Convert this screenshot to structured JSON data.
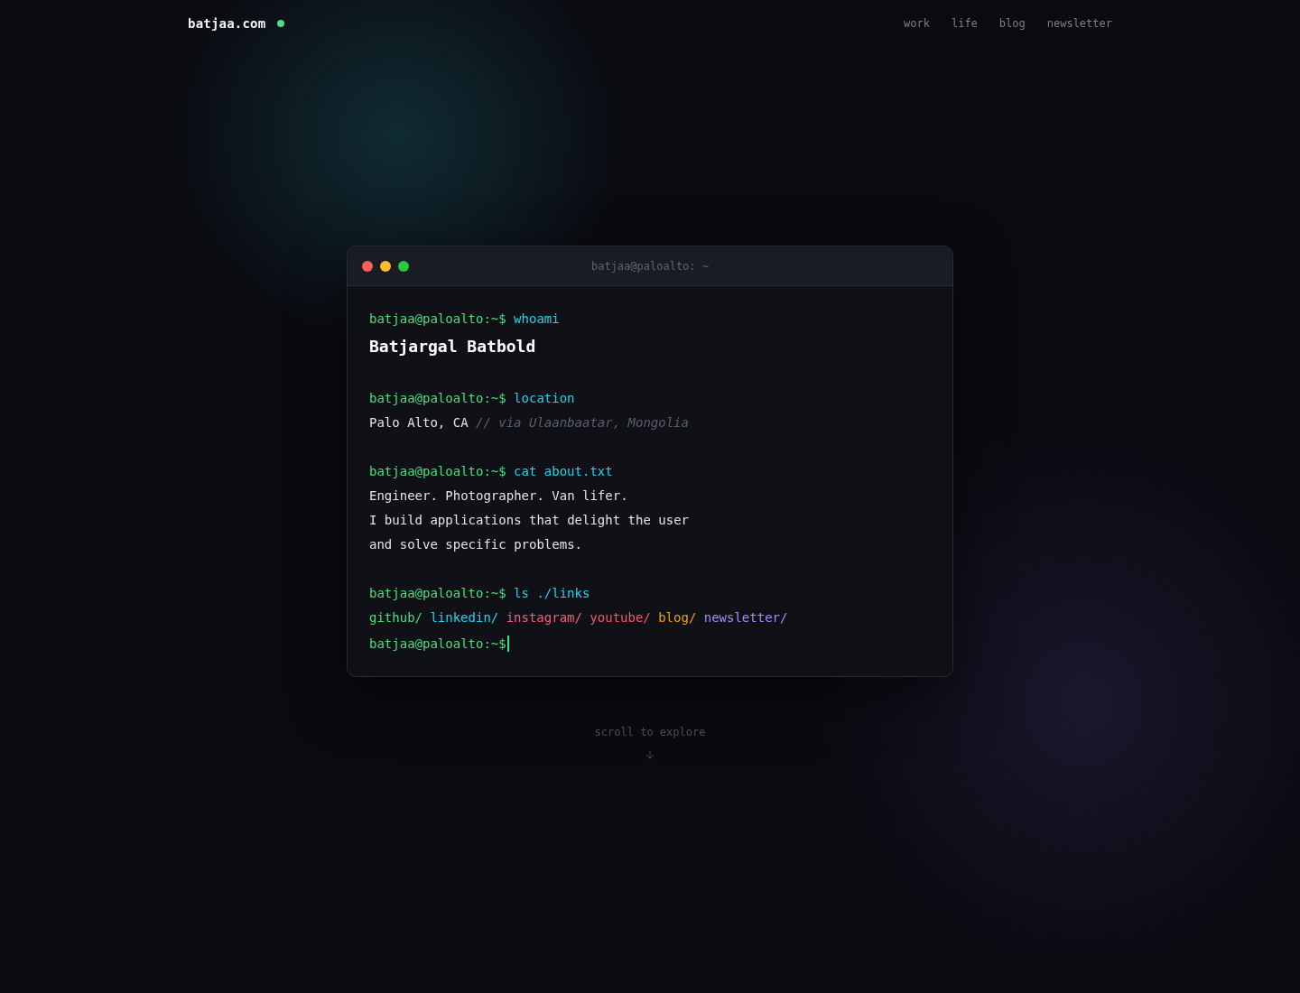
{
  "header": {
    "logo": "batjaa.com",
    "online": true,
    "nav": [
      {
        "label": "work"
      },
      {
        "label": "life"
      },
      {
        "label": "blog"
      },
      {
        "label": "newsletter"
      }
    ]
  },
  "terminal": {
    "title": "batjaa@paloalto: ~",
    "window_buttons": [
      {
        "color": "#ff5f57"
      },
      {
        "color": "#febc2e"
      },
      {
        "color": "#28c840"
      }
    ],
    "blocks": [
      {
        "prompt": "batjaa@paloalto:~$",
        "command": "whoami",
        "output": [
          {
            "kind": "heading",
            "text": "Batjargal Batbold"
          }
        ]
      },
      {
        "prompt": "batjaa@paloalto:~$",
        "command": "location",
        "output": [
          {
            "kind": "text",
            "text": "Palo Alto, CA",
            "comment": "// via Ulaanbaatar, Mongolia"
          }
        ]
      },
      {
        "prompt": "batjaa@paloalto:~$",
        "command": "cat about.txt",
        "output": [
          {
            "kind": "text",
            "text": "Engineer. Photographer. Van lifer."
          },
          {
            "kind": "text",
            "text": "I build applications that delight the user"
          },
          {
            "kind": "text",
            "text": "and solve specific problems."
          }
        ]
      },
      {
        "prompt": "batjaa@paloalto:~$",
        "command": "ls ./links",
        "output": [
          {
            "kind": "links",
            "items": [
              {
                "label": "github/",
                "color": "#4ade80"
              },
              {
                "label": "linkedin/",
                "color": "#22d3ee"
              },
              {
                "label": "instagram/",
                "color": "#f0607a"
              },
              {
                "label": "youtube/",
                "color": "#f05a6a"
              },
              {
                "label": "blog/",
                "color": "#f59e0b"
              },
              {
                "label": "newsletter/",
                "color": "#a78bfa"
              }
            ]
          }
        ]
      }
    ],
    "input": {
      "prompt": "batjaa@paloalto:~$",
      "cursor": true
    }
  },
  "scroll_hint": {
    "label": "scroll to explore"
  }
}
